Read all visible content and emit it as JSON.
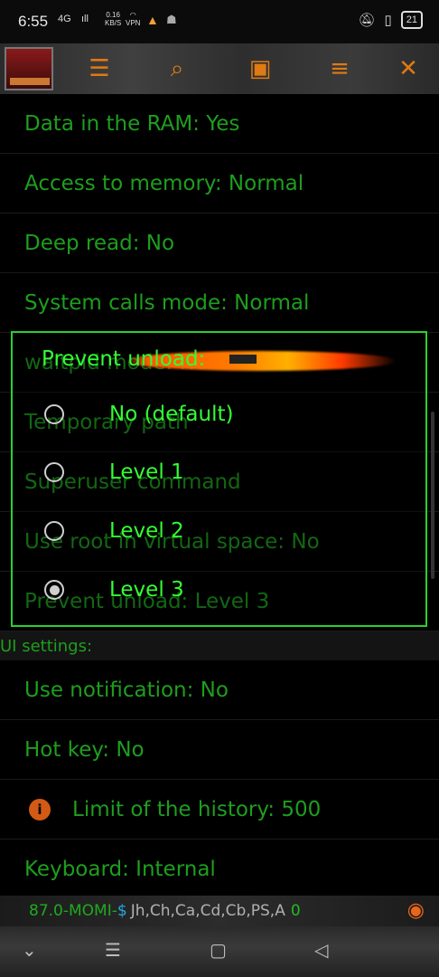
{
  "status_bar": {
    "time": "6:55",
    "signal1": "4G",
    "signal2": "ıll",
    "speed_value": "0.16",
    "speed_unit": "KB/S",
    "vpn_label": "VPN",
    "battery": "21"
  },
  "toolbar": {
    "icons": [
      "app-icon",
      "settings-sliders-icon",
      "search-icon",
      "save-icon",
      "list-icon",
      "close-icon"
    ]
  },
  "settings": {
    "rows": [
      "Data in the RAM: Yes",
      "Access to memory: Normal",
      "Deep read: No",
      "System calls mode: Normal",
      "waitpid mode: Normal",
      "Temporary path",
      "Superuser command",
      "Use root in virtual space: No",
      "Prevent unload: Level 3"
    ],
    "section_ui": "UI settings:",
    "rows_ui": [
      "Use notification: No",
      "Hot key: No",
      "Limit of the history: 500",
      "Keyboard: Internal"
    ]
  },
  "dialog": {
    "title": "Prevent unload:",
    "options": [
      {
        "label": "No (default)",
        "selected": false
      },
      {
        "label": "Level 1",
        "selected": false
      },
      {
        "label": "Level 2",
        "selected": false
      },
      {
        "label": "Level 3",
        "selected": true
      }
    ]
  },
  "info_bar": {
    "version": "87.0-MOMI-",
    "dollar": "$",
    "flags": "Jh,Ch,Ca,Cd,Cb,PS,A",
    "count": "0"
  },
  "colors": {
    "text_green": "#1e9e1e",
    "dialog_green": "#33ff33",
    "accent_orange": "#e07a12"
  }
}
